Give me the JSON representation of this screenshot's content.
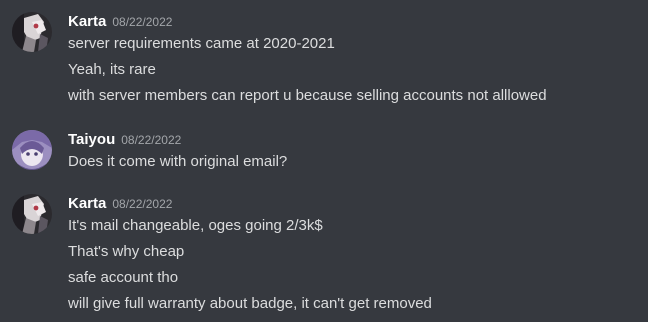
{
  "messages": [
    {
      "username": "Karta",
      "timestamp": "08/22/2022",
      "lines": [
        "server requirements came at 2020-2021",
        "Yeah, its rare",
        "with server members can report u because selling accounts not alllowed"
      ]
    },
    {
      "username": "Taiyou",
      "timestamp": "08/22/2022",
      "lines": [
        "Does it come with original email?"
      ]
    },
    {
      "username": "Karta",
      "timestamp": "08/22/2022",
      "lines": [
        "It's mail changeable, oges going 2/3k$",
        "That's why cheap",
        "safe account tho",
        "will give full warranty about badge, it can't get removed"
      ]
    }
  ],
  "colors": {
    "background": "#36393f",
    "username": "#ffffff",
    "timestamp": "#a3a6aa",
    "message_text": "#dcddde"
  }
}
